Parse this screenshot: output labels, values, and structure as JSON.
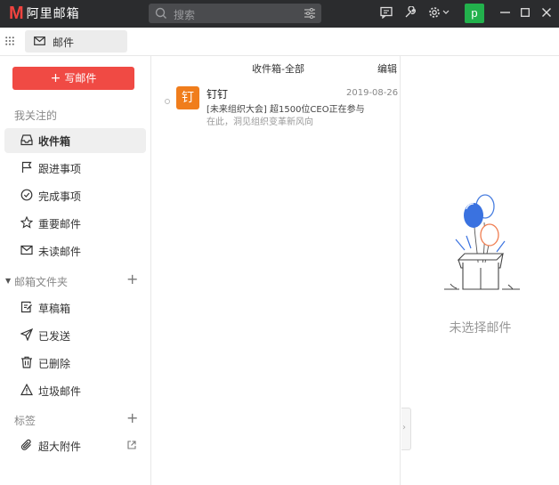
{
  "app": {
    "logo_mark": "M",
    "logo_text": "阿里邮箱"
  },
  "search": {
    "placeholder": "搜索"
  },
  "user": {
    "avatar_letter": "p"
  },
  "tab": {
    "label": "邮件"
  },
  "sidebar": {
    "compose_label": "写邮件",
    "favorites_label": "我关注的",
    "favorites": [
      {
        "label": "收件箱",
        "icon": "inbox-icon",
        "active": true
      },
      {
        "label": "跟进事项",
        "icon": "flag-icon"
      },
      {
        "label": "完成事项",
        "icon": "check-circle-icon"
      },
      {
        "label": "重要邮件",
        "icon": "star-icon"
      },
      {
        "label": "未读邮件",
        "icon": "envelope-icon"
      }
    ],
    "folders_label": "邮箱文件夹",
    "folders": [
      {
        "label": "草稿箱",
        "icon": "draft-icon"
      },
      {
        "label": "已发送",
        "icon": "send-icon"
      },
      {
        "label": "已删除",
        "icon": "trash-icon"
      },
      {
        "label": "垃圾邮件",
        "icon": "warning-icon"
      }
    ],
    "tags_label": "标签",
    "attachments_label": "超大附件"
  },
  "mail_list": {
    "title": "收件箱-全部",
    "edit_label": "编辑",
    "items": [
      {
        "avatar_char": "钉",
        "sender": "钉钉",
        "date": "2019-08-26",
        "subject": "[未来组织大会] 超1500位CEO正在参与",
        "preview": "在此，洞见组织变革新风向"
      }
    ]
  },
  "reading_pane": {
    "empty_text": "未选择邮件"
  },
  "colors": {
    "accent": "#f04a44",
    "titlebar": "#2b2c2e",
    "avatar_green": "#22b14c",
    "mail_avatar": "#f07d1c"
  }
}
